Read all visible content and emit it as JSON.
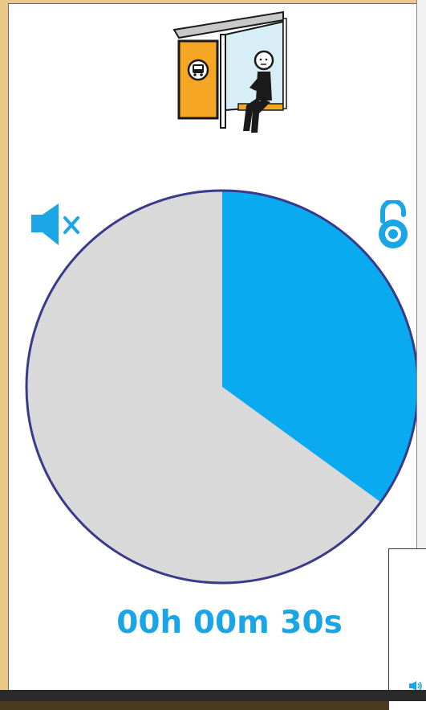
{
  "timer": {
    "remaining_text": "00h 00m 30s",
    "progress_fraction": 0.35,
    "fill_color": "#0aaaf0",
    "track_color": "#d9d9d9",
    "outline_color": "#3a3a8a"
  },
  "icons": {
    "pictogram": "bus-stop-waiting-person-icon",
    "mute": "speaker-muted-icon",
    "lock": "padlock-unlocked-icon",
    "overlay_sound": "speaker-icon"
  },
  "colors": {
    "accent": "#1aa6e6",
    "frame": "#e9c88a",
    "pictogram_orange": "#f5a623",
    "pictogram_glass": "#d7eef7"
  }
}
